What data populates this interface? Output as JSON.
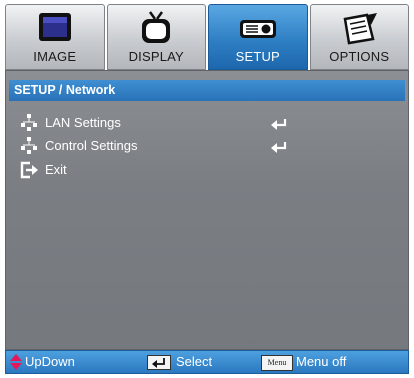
{
  "tabs": [
    {
      "label": "IMAGE",
      "icon": "monitor-icon",
      "active": false
    },
    {
      "label": "DISPLAY",
      "icon": "tv-icon",
      "active": false
    },
    {
      "label": "SETUP",
      "icon": "projector-icon",
      "active": true
    },
    {
      "label": "OPTIONS",
      "icon": "notepad-icon",
      "active": false
    }
  ],
  "breadcrumb": "SETUP / Network",
  "items": [
    {
      "label": "LAN Settings",
      "icon": "network-icon",
      "action": "enter-icon"
    },
    {
      "label": "Control Settings",
      "icon": "network-icon",
      "action": "enter-icon"
    },
    {
      "label": "Exit",
      "icon": "exit-icon"
    }
  ],
  "footer": {
    "updown": "UpDown",
    "select": "Select",
    "menu_key": "Menu",
    "menu_off": "Menu off"
  },
  "colors": {
    "accent": "#2f7fc4",
    "panel": "#7b7f84",
    "arrow": "#e2185b"
  }
}
